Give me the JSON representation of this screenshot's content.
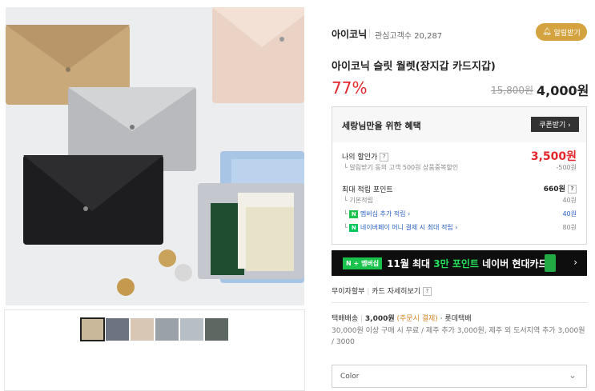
{
  "store": {
    "name": "아이코닉",
    "interest": "관심고객수 20,287",
    "alarm_label": "알림받기"
  },
  "product": {
    "title": "아이코닉 슬릿 월렛(장지갑 카드지갑)",
    "discount": "77%",
    "original_price": "15,800원",
    "sale_price": "4,000원"
  },
  "benefits": {
    "title": "세랑님만을 위한 혜택",
    "coupon_label": "쿠폰받기 ›",
    "my_price_label": "나의 할인가",
    "my_price": "3,500원",
    "my_price_sub": "알림받기 동의 고객 500원 상품중복할인",
    "my_price_diff": "-500원",
    "points_label": "최대 적립 포인트",
    "points_total": "660원",
    "points": [
      {
        "label": "기본적립",
        "value": "40원"
      },
      {
        "label": "멤버십 추가 적립 ›",
        "value": "40원"
      },
      {
        "label": "네이버페이 머니 결제 시 최대 적립 ›",
        "value": "80원"
      }
    ]
  },
  "banner": {
    "badge": "N + 멤버십",
    "text_prefix": "11월 최대 ",
    "text_highlight": "3만 포인트",
    "text_suffix": " 네이버 현대카드"
  },
  "installment": {
    "label": "무이자할부",
    "detail": "카드 자세히보기"
  },
  "shipping": {
    "type": "택배배송",
    "fee": "3,000원",
    "fee_note": "(주문시 결제)",
    "carrier": "· 롯데택배",
    "detail": "30,000원 이상 구매 시 무료 / 제주 추가 3,000원, 제주 외 도서지역 추가 3,000원 / 3000"
  },
  "option": {
    "placeholder": "Color"
  }
}
